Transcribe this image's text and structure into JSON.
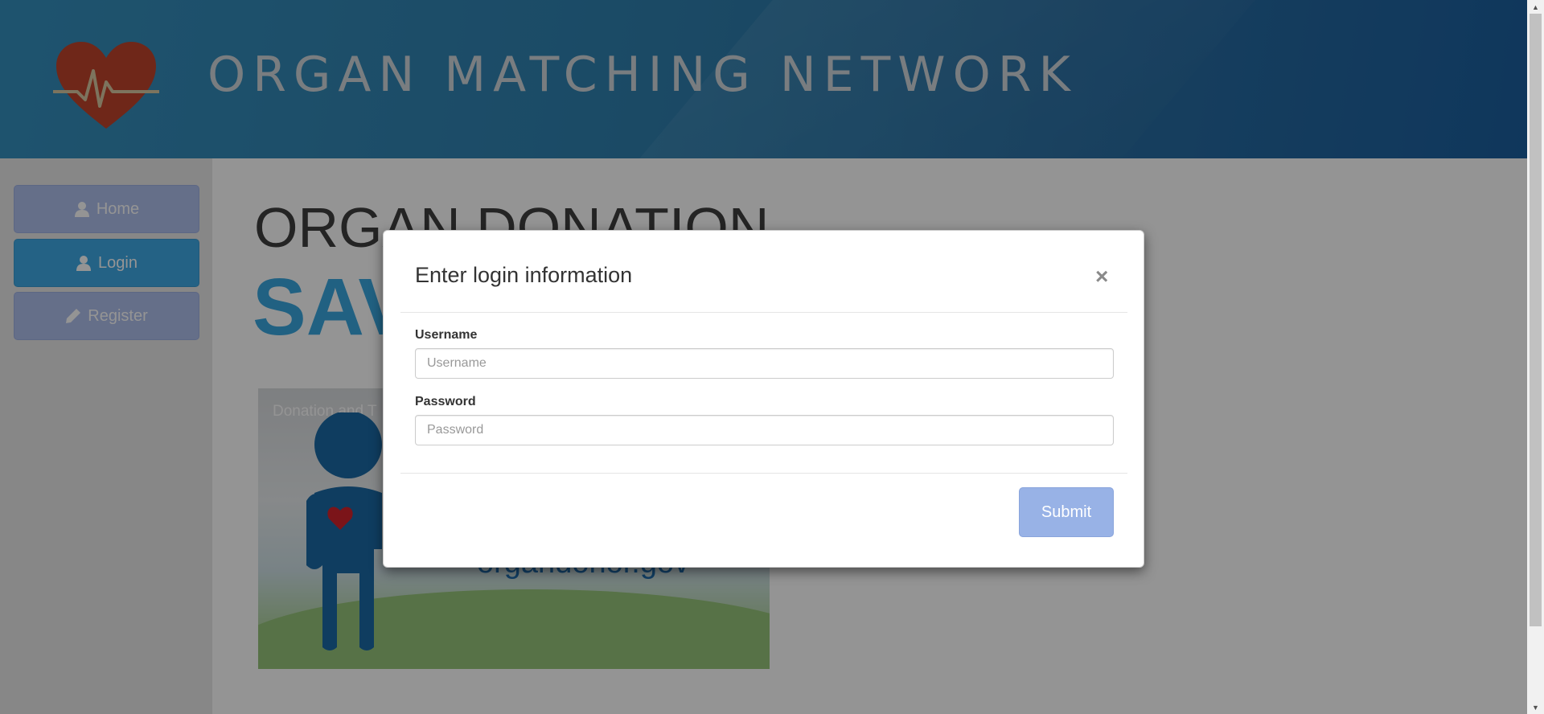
{
  "header": {
    "brand": "ORGAN MATCHING NETWORK",
    "logo_icon": "heartbeat-heart-icon"
  },
  "sidebar": {
    "items": [
      {
        "label": "Home",
        "icon": "user-icon",
        "active": false
      },
      {
        "label": "Login",
        "icon": "user-icon",
        "active": true
      },
      {
        "label": "Register",
        "icon": "pencil-icon",
        "active": false
      }
    ]
  },
  "main": {
    "title": "ORGAN DONATION",
    "subtitle": "SAV",
    "promo": {
      "caption": "Donation and T",
      "url_fragment": "organdonor.gov"
    }
  },
  "modal": {
    "title": "Enter login information",
    "close_label": "×",
    "username": {
      "label": "Username",
      "placeholder": "Username",
      "value": ""
    },
    "password": {
      "label": "Password",
      "placeholder": "Password",
      "value": ""
    },
    "submit_label": "Submit"
  },
  "colors": {
    "header": "#2f7fae",
    "accent": "#3fa9e6",
    "nav_button": "#afbfed",
    "submit": "#98b2e6",
    "logo_heart": "#c0442b"
  }
}
